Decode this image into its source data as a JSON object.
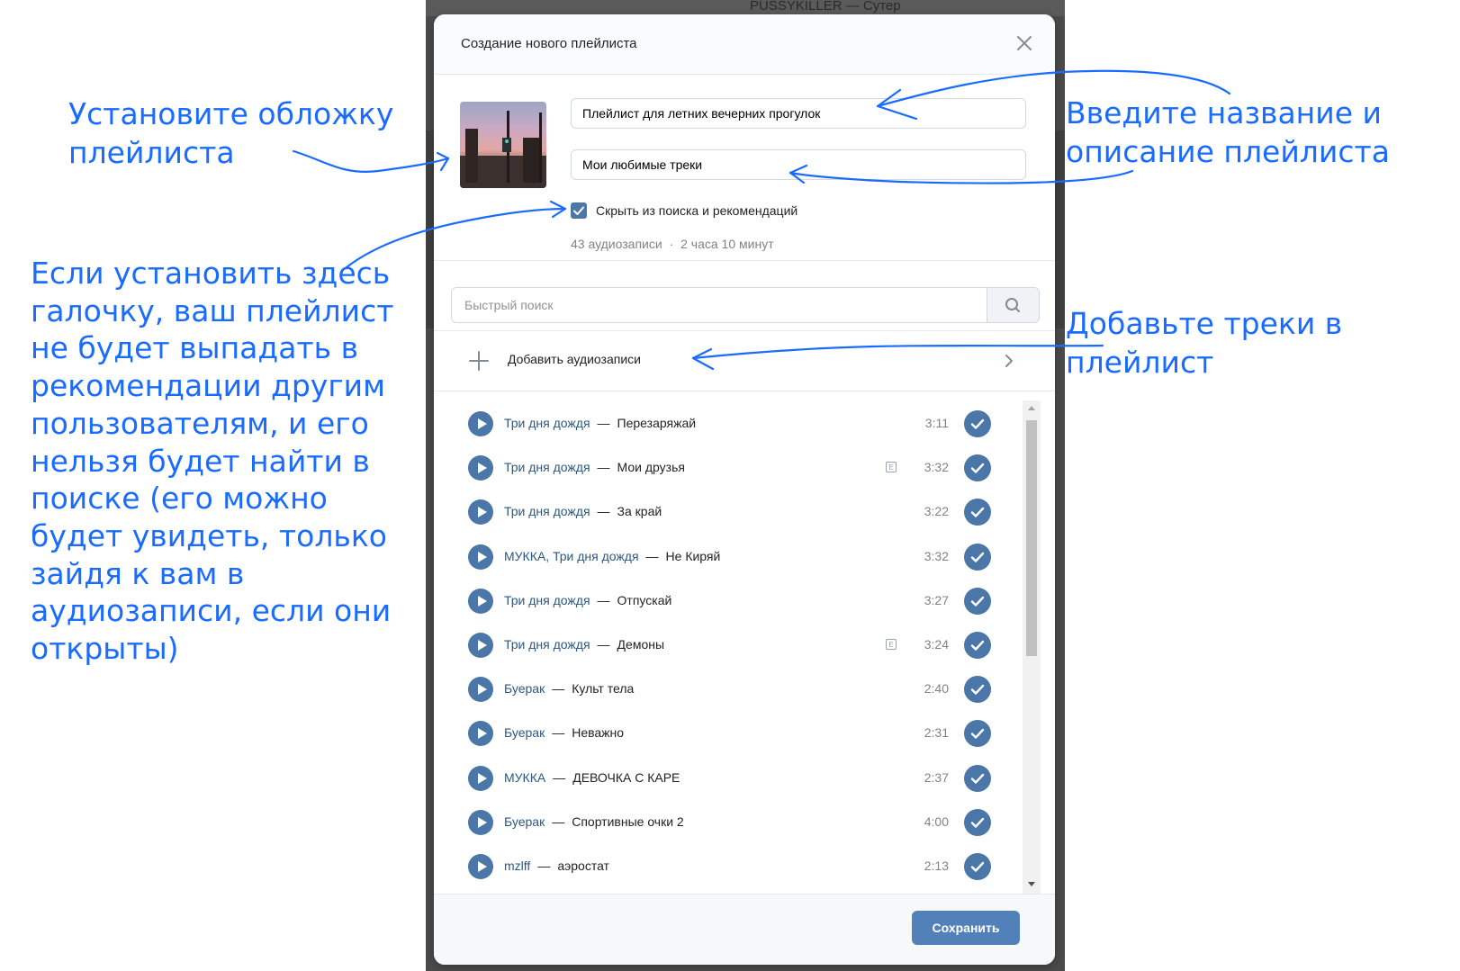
{
  "background": {
    "now_playing": "PUSSYKILLER — Сутер"
  },
  "modal": {
    "title": "Создание нового плейлиста",
    "name_value": "Плейлист для летних вечерних прогулок",
    "description_value": "Мои любимые треки",
    "hide_checkbox_label": "Скрыть из поиска и рекомендаций",
    "hide_checked": true,
    "meta_count": "43 аудиозаписи",
    "meta_separator": "·",
    "meta_duration": "2 часа 10 минут",
    "search_placeholder": "Быстрый поиск",
    "add_audio_label": "Добавить аудиозаписи",
    "save_label": "Сохранить"
  },
  "tracks": [
    {
      "artist": "Три дня дождя",
      "title": "Перезаряжай",
      "duration": "3:11",
      "explicit": false
    },
    {
      "artist": "Три дня дождя",
      "title": "Мои друзья",
      "duration": "3:32",
      "explicit": true
    },
    {
      "artist": "Три дня дождя",
      "title": "За край",
      "duration": "3:22",
      "explicit": false
    },
    {
      "artist": "МУККА, Три дня дождя",
      "title": "Не Киряй",
      "duration": "3:32",
      "explicit": false
    },
    {
      "artist": "Три дня дождя",
      "title": "Отпускай",
      "duration": "3:27",
      "explicit": false
    },
    {
      "artist": "Три дня дождя",
      "title": "Демоны",
      "duration": "3:24",
      "explicit": true
    },
    {
      "artist": "Буерак",
      "title": "Культ тела",
      "duration": "2:40",
      "explicit": false
    },
    {
      "artist": "Буерак",
      "title": "Неважно",
      "duration": "2:31",
      "explicit": false
    },
    {
      "artist": "МУККА",
      "title": "ДЕВОЧКА С КАРЕ",
      "duration": "2:37",
      "explicit": false
    },
    {
      "artist": "Буерак",
      "title": "Спортивные очки 2",
      "duration": "4:00",
      "explicit": false
    },
    {
      "artist": "mzlff",
      "title": "аэростат",
      "duration": "2:13",
      "explicit": false
    }
  ],
  "explicit_badge": "E",
  "annotations": {
    "cover_note": [
      "Установите обложку",
      "плейлиста"
    ],
    "name_note": [
      "Введите название и",
      "описание плейлиста"
    ],
    "checkbox_note": [
      "Если установить здесь",
      "галочку, ваш плейлист",
      "не будет выпадать в",
      "рекомендации другим",
      "пользователям, и его",
      "нельзя будет найти в",
      "поиске (его можно",
      "будет увидеть, только",
      "зайдя к вам в",
      "аудиозаписи, если они",
      "открыты)"
    ],
    "tracks_note": [
      "Добавьте треки в",
      "плейлист"
    ]
  },
  "colors": {
    "accent": "#4a76a8",
    "annotation": "#1a6bff",
    "artist_link": "#2a5885",
    "save_button": "#5181b8"
  },
  "icons": {
    "close": "close-icon",
    "search": "search-icon",
    "add": "plus-icon",
    "chevron": "chevron-right-icon",
    "play": "play-icon",
    "check": "check-icon"
  }
}
